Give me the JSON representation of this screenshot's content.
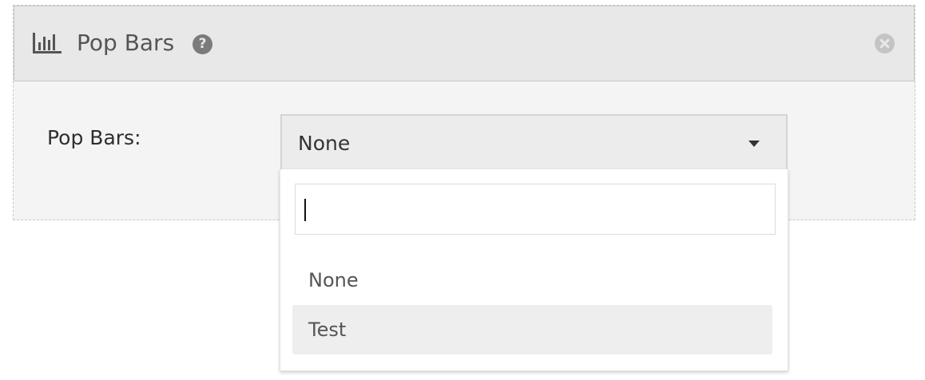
{
  "panel": {
    "title": "Pop Bars",
    "header_icon": "bar-chart-icon",
    "help_icon": "question-icon",
    "help_glyph": "?",
    "close_icon": "close-circle-icon"
  },
  "form": {
    "label": "Pop Bars:",
    "select": {
      "value": "None",
      "caret_icon": "caret-down-icon"
    }
  },
  "dropdown": {
    "search_value": "",
    "options": [
      {
        "label": "None",
        "highlighted": false
      },
      {
        "label": "Test",
        "highlighted": true
      }
    ]
  },
  "colors": {
    "header_bg": "#e8e8e8",
    "panel_bg": "#f4f4f4",
    "highlight_bg": "#eeeeee"
  }
}
